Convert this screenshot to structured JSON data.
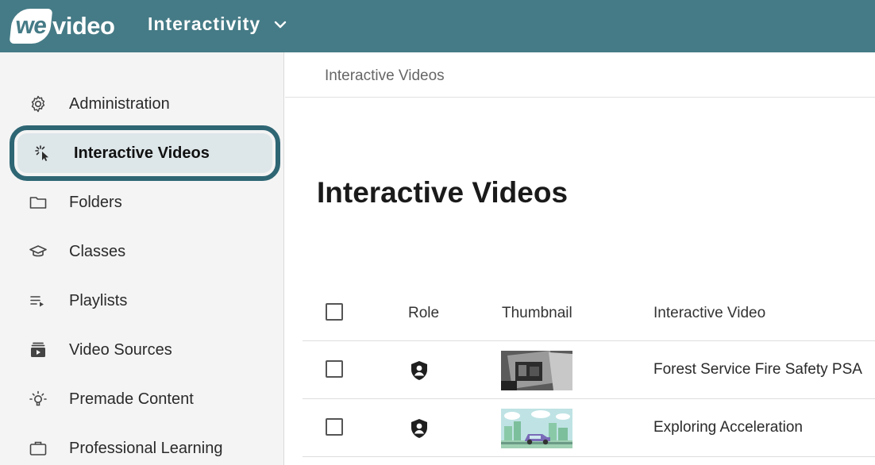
{
  "header": {
    "logo_we": "we",
    "logo_video": "video",
    "app_name": "Interactivity",
    "brand_color": "#457b86"
  },
  "sidebar": {
    "items": [
      {
        "label": "Administration",
        "icon": "gear-icon"
      },
      {
        "label": "Interactive Videos",
        "icon": "click-cursor-icon",
        "active": true
      },
      {
        "label": "Folders",
        "icon": "folder-icon"
      },
      {
        "label": "Classes",
        "icon": "graduation-cap-icon"
      },
      {
        "label": "Playlists",
        "icon": "playlist-icon"
      },
      {
        "label": "Video Sources",
        "icon": "video-sources-icon"
      },
      {
        "label": "Premade Content",
        "icon": "lightbulb-icon"
      },
      {
        "label": "Professional Learning",
        "icon": "briefcase-icon"
      }
    ],
    "highlight_color": "#2e6674"
  },
  "breadcrumb": "Interactive Videos",
  "page_title": "Interactive Videos",
  "table": {
    "columns": [
      "Role",
      "Thumbnail",
      "Interactive Video"
    ],
    "rows": [
      {
        "role_icon": "shield-user-icon",
        "thumbnail": "dark-photo-thumbnail",
        "name": "Forest Service Fire Safety PSA"
      },
      {
        "role_icon": "shield-user-icon",
        "thumbnail": "car-city-thumbnail",
        "name": "Exploring Acceleration"
      }
    ]
  }
}
